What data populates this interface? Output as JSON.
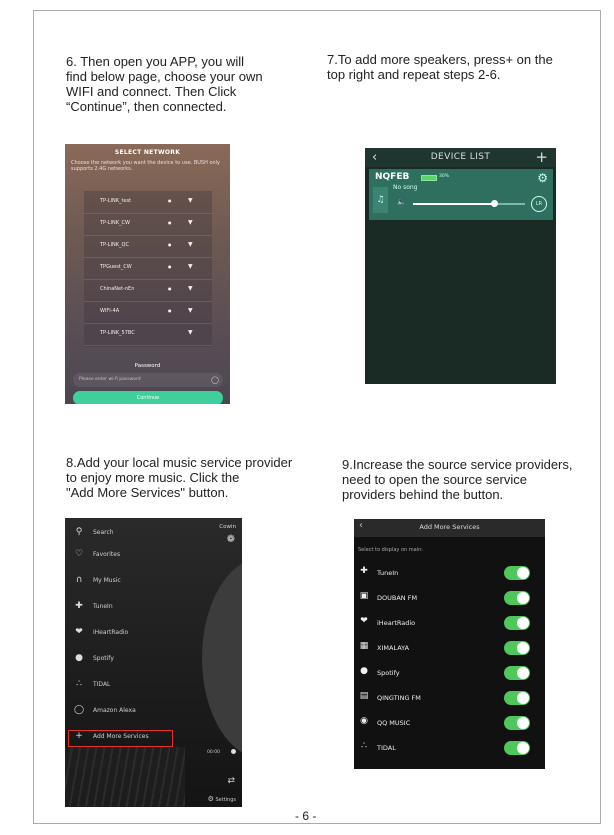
{
  "page": {
    "number": "- 6 -"
  },
  "captions": {
    "step6": "6. Then open you APP, you will\nfind below page, choose your own\nWIFI and connect. Then Click\n“Continue”, then connected.",
    "step7": "7.To add more speakers, press+ on the\ntop right and repeat steps 2-6.",
    "step8": "8.Add your local music service provider\nto enjoy more music. Click the\n\"Add More Services\" button.",
    "step9": "9.Increase the source service providers,\nneed to open the source service\nproviders behind the button."
  },
  "select_network": {
    "title": "SELECT NETWORK",
    "description": "Choose the network you want the device to use. BUSH only supports 2.4G networks.",
    "networks": [
      "TP-LINK_test",
      "TP-LINK_CW",
      "TP-LINK_QC",
      "TPGuest_CW",
      "ChinaNet-nEn",
      "WIFI-4A",
      "TP-LINK_57BC"
    ],
    "password_label": "Password",
    "password_placeholder": "Please enter wi-fi password",
    "continue_button": "Continue",
    "bg_color": "#5e4f55",
    "accent_color": "#3ecf9a"
  },
  "device_list": {
    "title": "DEVICE LIST",
    "device_name": "NQFEB",
    "battery_percent": "30%",
    "song": "No song",
    "channel": "LR",
    "volume_fraction": 0.72,
    "card_color": "#2f6f60"
  },
  "side_menu": {
    "header": "Cowin",
    "items": [
      "Search",
      "Favorites",
      "My Music",
      "TuneIn",
      "iHeartRadio",
      "Spotify",
      "TIDAL",
      "Amazon Alexa",
      "Add More Services"
    ],
    "time": "00:00",
    "settings_label": "Settings",
    "highlight_color": "#e0332b"
  },
  "add_services": {
    "title": "Add More Services",
    "subtitle": "Select to display on main:",
    "services": [
      "TuneIn",
      "DOUBAN FM",
      "iHeartRadio",
      "XIMALAYA",
      "Spotify",
      "QINGTING FM",
      "QQ MUSIC",
      "TIDAL"
    ],
    "toggle_color": "#4fc75a"
  }
}
